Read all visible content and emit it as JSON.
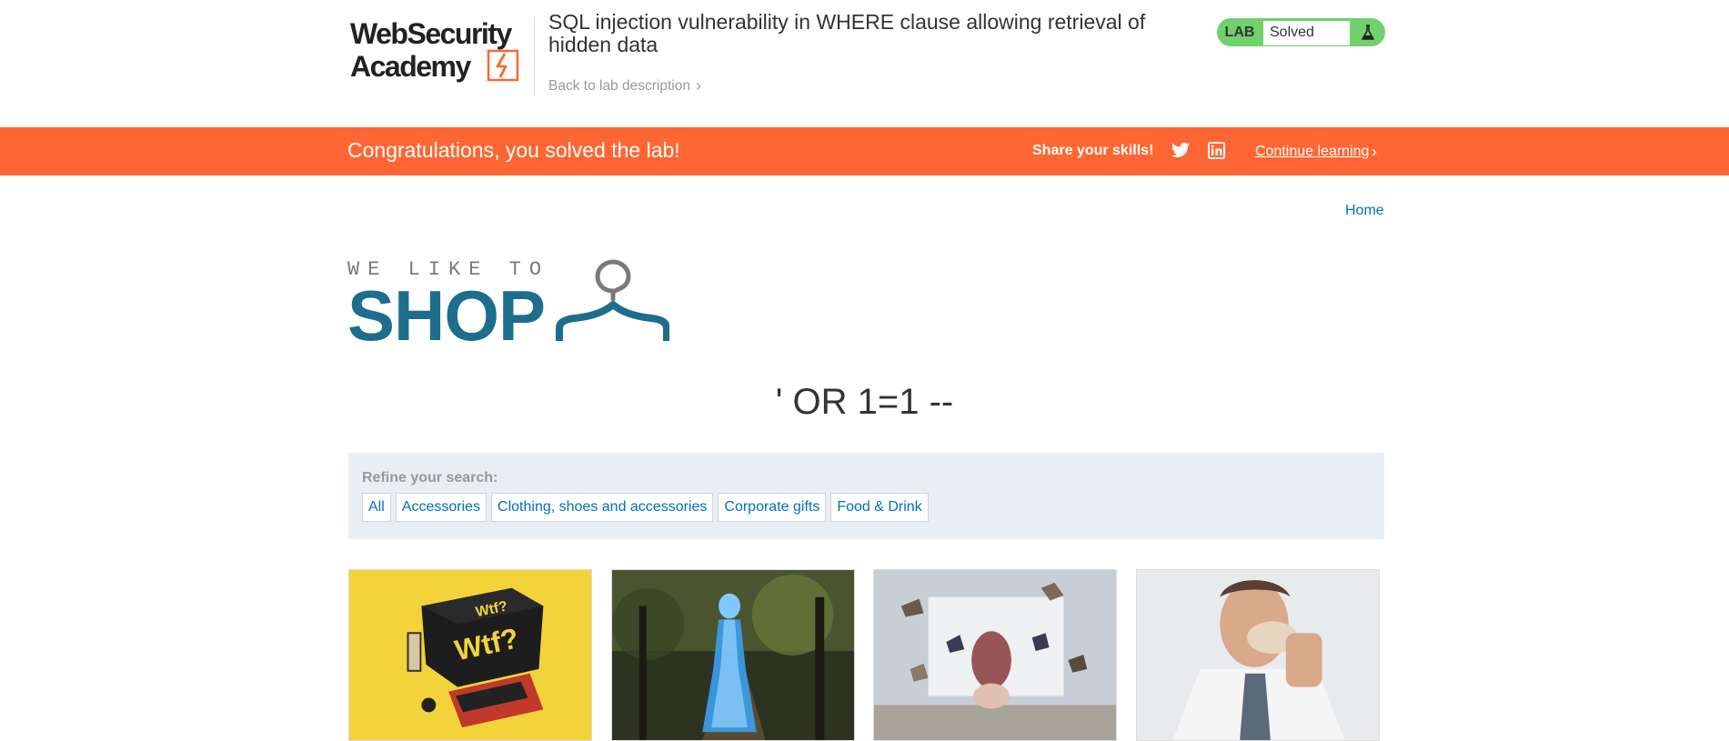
{
  "header": {
    "logo_text": "Web Security Academy",
    "lab_title": "SQL injection vulnerability in WHERE clause allowing retrieval of hidden data",
    "back_link": "Back to lab description"
  },
  "lab_status": {
    "tag": "LAB",
    "status": "Solved",
    "color": "#70d16d"
  },
  "banner": {
    "message": "Congratulations, you solved the lab!",
    "share_label": "Share your skills!",
    "continue_label": "Continue learning",
    "color": "#ff6633"
  },
  "nav": {
    "home": "Home"
  },
  "shop_logo": {
    "line1": "WE LIKE TO",
    "line2": "SHOP"
  },
  "search": {
    "heading": "' OR 1=1 --"
  },
  "filters": {
    "label": "Refine your search:",
    "items": [
      "All",
      "Accessories",
      "Clothing, shoes and accessories",
      "Corporate gifts",
      "Food & Drink"
    ]
  },
  "products": [
    {
      "image": "wtf-card-game-image"
    },
    {
      "image": "hologram-woman-park-image"
    },
    {
      "image": "flying-books-bed-image"
    },
    {
      "image": "man-eating-cookie-image"
    }
  ],
  "colors": {
    "link": "#0071bc",
    "shop_blue": "#1c6e8c"
  }
}
